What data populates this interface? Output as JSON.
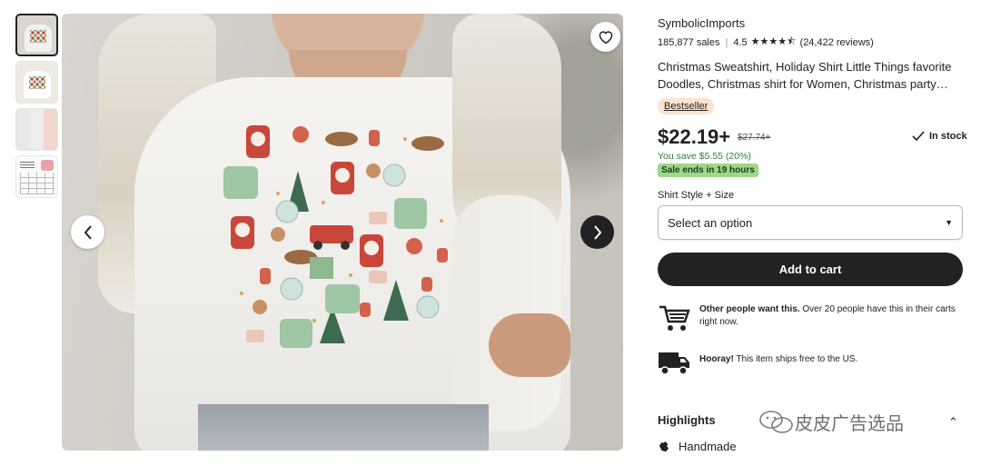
{
  "thumbnails": [
    {
      "name": "thumb-1",
      "active": true
    },
    {
      "name": "thumb-2",
      "active": false
    },
    {
      "name": "thumb-3",
      "active": false
    },
    {
      "name": "thumb-4",
      "active": false
    }
  ],
  "shop": {
    "name": "SymbolicImports",
    "sales": "185,877 sales",
    "rating": "4.5",
    "stars_value": 4.5,
    "reviews": "(24,422 reviews)"
  },
  "listing": {
    "title": "Christmas Sweatshirt, Holiday Shirt Little Things favorite Doodles, Christmas shirt for Women, Christmas party…",
    "badge": "Bestseller",
    "price": "$22.19+",
    "old_price": "$27.74+",
    "stock": "In stock",
    "savings": "You save $5.55 (20%)",
    "sale_notice": "Sale ends in 19 hours"
  },
  "options": {
    "label": "Shirt Style + Size",
    "selected": "Select an option"
  },
  "cart_button": "Add to cart",
  "info": {
    "demand_bold": "Other people want this.",
    "demand_rest": " Over 20 people have this in their carts right now.",
    "shipping_bold": "Hooray!",
    "shipping_rest": " This item ships free to the US."
  },
  "highlights": {
    "title": "Highlights",
    "item": "Handmade"
  },
  "watermark": "皮皮广告选品",
  "colors": {
    "cart_button": "#222222",
    "badge_bg": "#fbe3d0",
    "sale_bg": "#9ed68a",
    "savings_text": "#2f7d33"
  },
  "icons": [
    "heart-icon",
    "chevron-left-icon",
    "chevron-right-icon",
    "check-icon",
    "cart-icon",
    "truck-icon",
    "hand-icon",
    "chevron-up-icon",
    "wechat-icon"
  ]
}
